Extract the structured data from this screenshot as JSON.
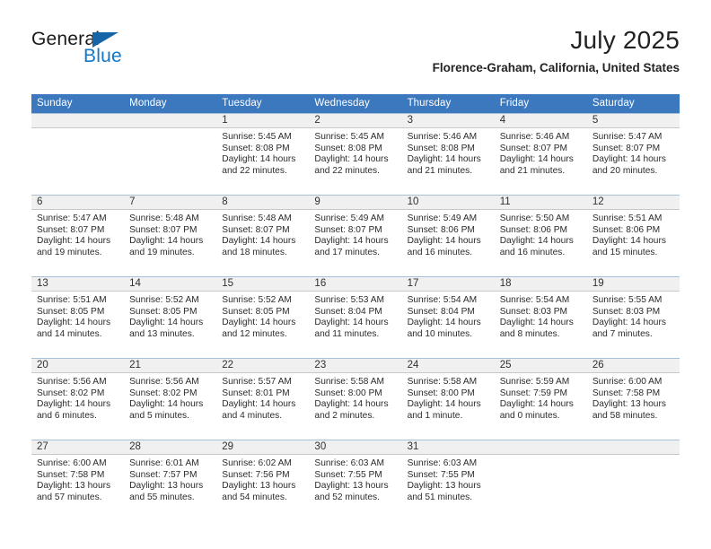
{
  "brand": {
    "name_part1": "General",
    "name_part2": "Blue",
    "triangle_color": "#1565a8",
    "blue_color": "#1278c8"
  },
  "header": {
    "month_title": "July 2025",
    "location": "Florence-Graham, California, United States"
  },
  "theme": {
    "header_bg": "#3b78bd",
    "header_text": "#ffffff",
    "daynum_band_bg": "#f0f0f0",
    "grid_line": "#a9c0da",
    "body_text": "#2b2b2b"
  },
  "weekday_headers": [
    "Sunday",
    "Monday",
    "Tuesday",
    "Wednesday",
    "Thursday",
    "Friday",
    "Saturday"
  ],
  "labels": {
    "sunrise_prefix": "Sunrise:",
    "sunset_prefix": "Sunset:",
    "daylight_prefix": "Daylight:"
  },
  "weeks": [
    [
      {
        "empty": true
      },
      {
        "empty": true
      },
      {
        "day": "1",
        "sunrise": "Sunrise: 5:45 AM",
        "sunset": "Sunset: 8:08 PM",
        "daylight_line1": "Daylight: 14 hours",
        "daylight_line2": "and 22 minutes."
      },
      {
        "day": "2",
        "sunrise": "Sunrise: 5:45 AM",
        "sunset": "Sunset: 8:08 PM",
        "daylight_line1": "Daylight: 14 hours",
        "daylight_line2": "and 22 minutes."
      },
      {
        "day": "3",
        "sunrise": "Sunrise: 5:46 AM",
        "sunset": "Sunset: 8:08 PM",
        "daylight_line1": "Daylight: 14 hours",
        "daylight_line2": "and 21 minutes."
      },
      {
        "day": "4",
        "sunrise": "Sunrise: 5:46 AM",
        "sunset": "Sunset: 8:07 PM",
        "daylight_line1": "Daylight: 14 hours",
        "daylight_line2": "and 21 minutes."
      },
      {
        "day": "5",
        "sunrise": "Sunrise: 5:47 AM",
        "sunset": "Sunset: 8:07 PM",
        "daylight_line1": "Daylight: 14 hours",
        "daylight_line2": "and 20 minutes."
      }
    ],
    [
      {
        "day": "6",
        "sunrise": "Sunrise: 5:47 AM",
        "sunset": "Sunset: 8:07 PM",
        "daylight_line1": "Daylight: 14 hours",
        "daylight_line2": "and 19 minutes."
      },
      {
        "day": "7",
        "sunrise": "Sunrise: 5:48 AM",
        "sunset": "Sunset: 8:07 PM",
        "daylight_line1": "Daylight: 14 hours",
        "daylight_line2": "and 19 minutes."
      },
      {
        "day": "8",
        "sunrise": "Sunrise: 5:48 AM",
        "sunset": "Sunset: 8:07 PM",
        "daylight_line1": "Daylight: 14 hours",
        "daylight_line2": "and 18 minutes."
      },
      {
        "day": "9",
        "sunrise": "Sunrise: 5:49 AM",
        "sunset": "Sunset: 8:07 PM",
        "daylight_line1": "Daylight: 14 hours",
        "daylight_line2": "and 17 minutes."
      },
      {
        "day": "10",
        "sunrise": "Sunrise: 5:49 AM",
        "sunset": "Sunset: 8:06 PM",
        "daylight_line1": "Daylight: 14 hours",
        "daylight_line2": "and 16 minutes."
      },
      {
        "day": "11",
        "sunrise": "Sunrise: 5:50 AM",
        "sunset": "Sunset: 8:06 PM",
        "daylight_line1": "Daylight: 14 hours",
        "daylight_line2": "and 16 minutes."
      },
      {
        "day": "12",
        "sunrise": "Sunrise: 5:51 AM",
        "sunset": "Sunset: 8:06 PM",
        "daylight_line1": "Daylight: 14 hours",
        "daylight_line2": "and 15 minutes."
      }
    ],
    [
      {
        "day": "13",
        "sunrise": "Sunrise: 5:51 AM",
        "sunset": "Sunset: 8:05 PM",
        "daylight_line1": "Daylight: 14 hours",
        "daylight_line2": "and 14 minutes."
      },
      {
        "day": "14",
        "sunrise": "Sunrise: 5:52 AM",
        "sunset": "Sunset: 8:05 PM",
        "daylight_line1": "Daylight: 14 hours",
        "daylight_line2": "and 13 minutes."
      },
      {
        "day": "15",
        "sunrise": "Sunrise: 5:52 AM",
        "sunset": "Sunset: 8:05 PM",
        "daylight_line1": "Daylight: 14 hours",
        "daylight_line2": "and 12 minutes."
      },
      {
        "day": "16",
        "sunrise": "Sunrise: 5:53 AM",
        "sunset": "Sunset: 8:04 PM",
        "daylight_line1": "Daylight: 14 hours",
        "daylight_line2": "and 11 minutes."
      },
      {
        "day": "17",
        "sunrise": "Sunrise: 5:54 AM",
        "sunset": "Sunset: 8:04 PM",
        "daylight_line1": "Daylight: 14 hours",
        "daylight_line2": "and 10 minutes."
      },
      {
        "day": "18",
        "sunrise": "Sunrise: 5:54 AM",
        "sunset": "Sunset: 8:03 PM",
        "daylight_line1": "Daylight: 14 hours",
        "daylight_line2": "and 8 minutes."
      },
      {
        "day": "19",
        "sunrise": "Sunrise: 5:55 AM",
        "sunset": "Sunset: 8:03 PM",
        "daylight_line1": "Daylight: 14 hours",
        "daylight_line2": "and 7 minutes."
      }
    ],
    [
      {
        "day": "20",
        "sunrise": "Sunrise: 5:56 AM",
        "sunset": "Sunset: 8:02 PM",
        "daylight_line1": "Daylight: 14 hours",
        "daylight_line2": "and 6 minutes."
      },
      {
        "day": "21",
        "sunrise": "Sunrise: 5:56 AM",
        "sunset": "Sunset: 8:02 PM",
        "daylight_line1": "Daylight: 14 hours",
        "daylight_line2": "and 5 minutes."
      },
      {
        "day": "22",
        "sunrise": "Sunrise: 5:57 AM",
        "sunset": "Sunset: 8:01 PM",
        "daylight_line1": "Daylight: 14 hours",
        "daylight_line2": "and 4 minutes."
      },
      {
        "day": "23",
        "sunrise": "Sunrise: 5:58 AM",
        "sunset": "Sunset: 8:00 PM",
        "daylight_line1": "Daylight: 14 hours",
        "daylight_line2": "and 2 minutes."
      },
      {
        "day": "24",
        "sunrise": "Sunrise: 5:58 AM",
        "sunset": "Sunset: 8:00 PM",
        "daylight_line1": "Daylight: 14 hours",
        "daylight_line2": "and 1 minute."
      },
      {
        "day": "25",
        "sunrise": "Sunrise: 5:59 AM",
        "sunset": "Sunset: 7:59 PM",
        "daylight_line1": "Daylight: 14 hours",
        "daylight_line2": "and 0 minutes."
      },
      {
        "day": "26",
        "sunrise": "Sunrise: 6:00 AM",
        "sunset": "Sunset: 7:58 PM",
        "daylight_line1": "Daylight: 13 hours",
        "daylight_line2": "and 58 minutes."
      }
    ],
    [
      {
        "day": "27",
        "sunrise": "Sunrise: 6:00 AM",
        "sunset": "Sunset: 7:58 PM",
        "daylight_line1": "Daylight: 13 hours",
        "daylight_line2": "and 57 minutes."
      },
      {
        "day": "28",
        "sunrise": "Sunrise: 6:01 AM",
        "sunset": "Sunset: 7:57 PM",
        "daylight_line1": "Daylight: 13 hours",
        "daylight_line2": "and 55 minutes."
      },
      {
        "day": "29",
        "sunrise": "Sunrise: 6:02 AM",
        "sunset": "Sunset: 7:56 PM",
        "daylight_line1": "Daylight: 13 hours",
        "daylight_line2": "and 54 minutes."
      },
      {
        "day": "30",
        "sunrise": "Sunrise: 6:03 AM",
        "sunset": "Sunset: 7:55 PM",
        "daylight_line1": "Daylight: 13 hours",
        "daylight_line2": "and 52 minutes."
      },
      {
        "day": "31",
        "sunrise": "Sunrise: 6:03 AM",
        "sunset": "Sunset: 7:55 PM",
        "daylight_line1": "Daylight: 13 hours",
        "daylight_line2": "and 51 minutes."
      },
      {
        "empty": true
      },
      {
        "empty": true
      }
    ]
  ]
}
